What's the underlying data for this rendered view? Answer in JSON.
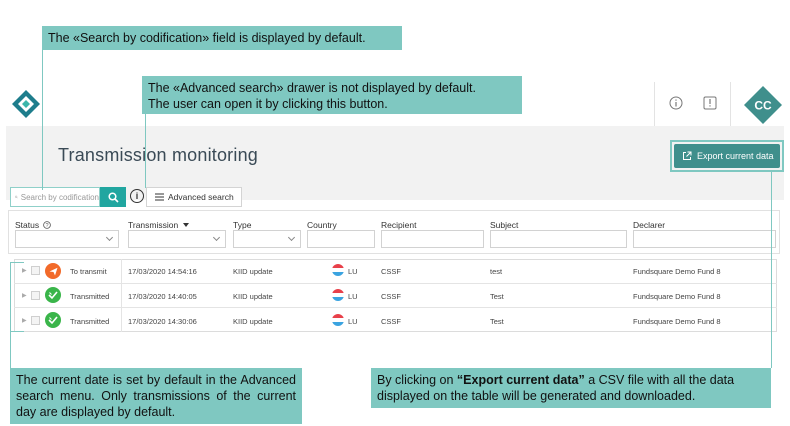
{
  "header": {
    "avatar_initials": "CC",
    "info_icon": "info-circle-icon",
    "alert_icon": "exclamation-square-icon"
  },
  "page": {
    "title": "Transmission monitoring",
    "export_label": "Export current data"
  },
  "search": {
    "placeholder": "Search by codification",
    "advanced_label": "Advanced search"
  },
  "table": {
    "columns": [
      "Status",
      "Transmission",
      "Type",
      "Country",
      "Recipient",
      "Subject",
      "Declarer"
    ],
    "rows": [
      {
        "status": "To transmit",
        "status_kind": "send",
        "transmission": "17/03/2020 14:54:16",
        "type": "KIID update",
        "country": "LU",
        "recipient": "CSSF",
        "subject": "test",
        "declarer": "Fundsquare Demo Fund 8"
      },
      {
        "status": "Transmitted",
        "status_kind": "done",
        "transmission": "17/03/2020 14:40:05",
        "type": "KIID update",
        "country": "LU",
        "recipient": "CSSF",
        "subject": "Test",
        "declarer": "Fundsquare Demo Fund 8"
      },
      {
        "status": "Transmitted",
        "status_kind": "done",
        "transmission": "17/03/2020 14:30:06",
        "type": "KIID update",
        "country": "LU",
        "recipient": "CSSF",
        "subject": "Test",
        "declarer": "Fundsquare Demo Fund 8"
      }
    ]
  },
  "callouts": {
    "search_default": "The «Search by codification» field is displayed by default.",
    "advanced_drawer_1": "The «Advanced search» drawer is not displayed by default.",
    "advanced_drawer_2": "The user can open it by clicking this button.",
    "current_date": "The current date is set by default in the Advanced search menu. Only transmissions of the current day are displayed by default.",
    "export_prefix": "By clicking on ",
    "export_bold": "“Export current data”",
    "export_suffix": " a CSV file with all the data displayed on the table will be generated and downloaded."
  },
  "colors": {
    "accent": "#21a6a0",
    "callout": "#7fc8c1",
    "status_send": "#f26a2a",
    "status_done": "#3ab54a",
    "flag_red": "#e8404a",
    "flag_blue": "#3aa3e0"
  }
}
